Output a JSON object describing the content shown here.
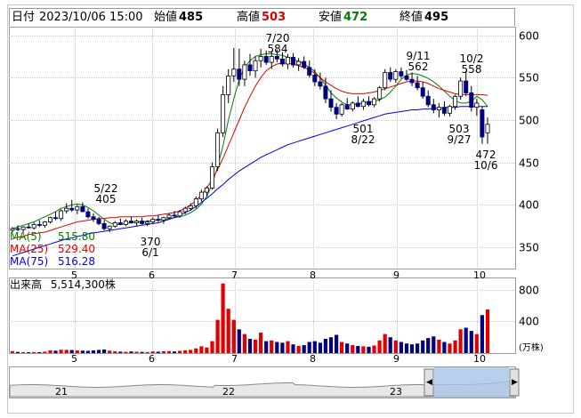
{
  "header": {
    "date_label": "日付",
    "date_value": "2023/10/06 15:00",
    "open_label": "始値",
    "open_value": "485",
    "high_label": "高値",
    "high_value": "503",
    "low_label": "安値",
    "low_value": "472",
    "close_label": "終値",
    "close_value": "495"
  },
  "moving_averages": [
    {
      "label": "MA(5)",
      "value": "515.80",
      "color": "#008000"
    },
    {
      "label": "MA(25)",
      "value": "529.40",
      "color": "#e00000"
    },
    {
      "label": "MA(75)",
      "value": "516.28",
      "color": "#0000e0"
    }
  ],
  "volume_header": {
    "label": "出来高",
    "value": "5,514,300株"
  },
  "volume_unit": "(万株)",
  "colors": {
    "up": "#ffffff",
    "down": "#000080",
    "vol_up": "#e00000",
    "vol_down": "#000080",
    "grid": "#c8c8c8",
    "navigator": "#a8c4e8"
  },
  "chart_data": {
    "type": "candlestick",
    "x_tick_labels": [
      "5",
      "6",
      "7",
      "8",
      "9",
      "10"
    ],
    "price_ylim": [
      325,
      610
    ],
    "price_ticks": [
      350,
      400,
      450,
      500,
      550,
      600
    ],
    "volume_ticks": [
      400,
      800
    ],
    "volume_ylim": [
      0,
      1000
    ],
    "annotations": [
      {
        "date": "5/22",
        "price": "405"
      },
      {
        "date": "6/1",
        "price": "370"
      },
      {
        "date": "7/20",
        "price": "584"
      },
      {
        "date": "8/22",
        "price": "501"
      },
      {
        "date": "9/11",
        "price": "562"
      },
      {
        "date": "9/27",
        "price": "503"
      },
      {
        "date": "10/2",
        "price": "558"
      },
      {
        "date": "10/6",
        "price": "472"
      }
    ],
    "series": [
      {
        "name": "MA(5)",
        "values": [
          372,
          374,
          376,
          378,
          380,
          383,
          386,
          389,
          392,
          396,
          398,
          400,
          401,
          400,
          397,
          393,
          388,
          383,
          379,
          377,
          377,
          378,
          379,
          380,
          380,
          381,
          382,
          382,
          383,
          384,
          385,
          386,
          388,
          391,
          395,
          401,
          410,
          425,
          445,
          470,
          500,
          525,
          548,
          562,
          570,
          575,
          577,
          578,
          578,
          577,
          576,
          574,
          572,
          569,
          566,
          562,
          557,
          550,
          541,
          532,
          526,
          521,
          518,
          518,
          519,
          520,
          521,
          522,
          524,
          527,
          533,
          540,
          548,
          553,
          555,
          554,
          552,
          549,
          545,
          540,
          534,
          528,
          523,
          520,
          520,
          522,
          528,
          524,
          516
        ]
      },
      {
        "name": "MA(25)",
        "values": [
          360,
          362,
          363,
          365,
          366,
          367,
          368,
          370,
          372,
          374,
          376,
          378,
          380,
          381,
          382,
          383,
          384,
          384,
          385,
          385,
          386,
          386,
          386,
          386,
          386,
          387,
          387,
          388,
          389,
          390,
          391,
          393,
          396,
          400,
          405,
          412,
          420,
          430,
          442,
          455,
          470,
          485,
          500,
          515,
          528,
          540,
          550,
          558,
          563,
          566,
          567,
          567,
          566,
          564,
          562,
          559,
          555,
          550,
          545,
          541,
          537,
          534,
          532,
          531,
          531,
          531,
          532,
          533,
          535,
          537,
          539,
          541,
          543,
          545,
          546,
          546,
          545,
          543,
          540,
          537,
          535,
          533,
          531,
          530,
          530,
          530,
          530,
          530,
          529
        ]
      },
      {
        "name": "MA(75)",
        "values": [
          340,
          342,
          344,
          346,
          348,
          350,
          352,
          354,
          356,
          358,
          360,
          361,
          363,
          364,
          366,
          367,
          368,
          369,
          370,
          371,
          372,
          373,
          374,
          375,
          376,
          377,
          378,
          379,
          381,
          383,
          385,
          388,
          391,
          394,
          398,
          403,
          408,
          413,
          419,
          424,
          430,
          435,
          440,
          444,
          448,
          452,
          456,
          459,
          462,
          465,
          468,
          471,
          473,
          475,
          477,
          479,
          481,
          483,
          485,
          487,
          489,
          491,
          493,
          495,
          497,
          499,
          501,
          503,
          505,
          507,
          508,
          509,
          510,
          511,
          512,
          512,
          513,
          513,
          514,
          514,
          515,
          515,
          515,
          516,
          516,
          516,
          516,
          516,
          516
        ]
      }
    ],
    "candles": [
      [
        370,
        374,
        368,
        372,
        25
      ],
      [
        372,
        376,
        369,
        371,
        15
      ],
      [
        371,
        375,
        368,
        374,
        12
      ],
      [
        374,
        378,
        372,
        373,
        10
      ],
      [
        373,
        379,
        371,
        377,
        14
      ],
      [
        377,
        382,
        374,
        376,
        12
      ],
      [
        376,
        381,
        373,
        380,
        18
      ],
      [
        380,
        386,
        378,
        385,
        35
      ],
      [
        385,
        392,
        382,
        384,
        30
      ],
      [
        384,
        395,
        381,
        393,
        42
      ],
      [
        393,
        402,
        390,
        396,
        40
      ],
      [
        396,
        406,
        392,
        394,
        38
      ],
      [
        394,
        400,
        389,
        398,
        33
      ],
      [
        398,
        403,
        393,
        392,
        30
      ],
      [
        392,
        396,
        384,
        386,
        28
      ],
      [
        386,
        390,
        380,
        383,
        34
      ],
      [
        383,
        386,
        376,
        378,
        40
      ],
      [
        378,
        382,
        370,
        372,
        45
      ],
      [
        372,
        376,
        368,
        375,
        30
      ],
      [
        375,
        381,
        373,
        379,
        22
      ],
      [
        379,
        384,
        376,
        377,
        18
      ],
      [
        377,
        383,
        375,
        381,
        16
      ],
      [
        381,
        386,
        378,
        379,
        20
      ],
      [
        379,
        383,
        375,
        381,
        17
      ],
      [
        381,
        385,
        377,
        378,
        15
      ],
      [
        378,
        382,
        375,
        380,
        14
      ],
      [
        380,
        385,
        378,
        383,
        20
      ],
      [
        383,
        388,
        380,
        382,
        18
      ],
      [
        382,
        386,
        378,
        385,
        22
      ],
      [
        385,
        390,
        383,
        388,
        25
      ],
      [
        388,
        393,
        385,
        387,
        20
      ],
      [
        387,
        394,
        385,
        392,
        28
      ],
      [
        392,
        398,
        389,
        396,
        35
      ],
      [
        396,
        402,
        393,
        399,
        40
      ],
      [
        399,
        410,
        396,
        407,
        60
      ],
      [
        407,
        418,
        404,
        415,
        85
      ],
      [
        415,
        422,
        410,
        420,
        70
      ],
      [
        420,
        450,
        418,
        445,
        150
      ],
      [
        445,
        490,
        440,
        485,
        420
      ],
      [
        485,
        540,
        480,
        530,
        880
      ],
      [
        530,
        560,
        520,
        552,
        560
      ],
      [
        552,
        585,
        545,
        560,
        420
      ],
      [
        560,
        584,
        540,
        548,
        300
      ],
      [
        548,
        570,
        540,
        565,
        240
      ],
      [
        565,
        578,
        552,
        558,
        180
      ],
      [
        558,
        575,
        550,
        570,
        170
      ],
      [
        570,
        584,
        562,
        575,
        260
      ],
      [
        575,
        582,
        565,
        568,
        150
      ],
      [
        568,
        580,
        560,
        575,
        160
      ],
      [
        575,
        583,
        568,
        572,
        140
      ],
      [
        572,
        580,
        563,
        566,
        130
      ],
      [
        566,
        578,
        560,
        574,
        150
      ],
      [
        574,
        579,
        562,
        565,
        110
      ],
      [
        565,
        573,
        558,
        569,
        90
      ],
      [
        569,
        575,
        560,
        562,
        100
      ],
      [
        562,
        570,
        550,
        553,
        140
      ],
      [
        553,
        560,
        540,
        545,
        150
      ],
      [
        545,
        556,
        536,
        540,
        130
      ],
      [
        540,
        550,
        520,
        525,
        180
      ],
      [
        525,
        535,
        510,
        515,
        200
      ],
      [
        515,
        520,
        501,
        507,
        230
      ],
      [
        507,
        520,
        504,
        518,
        140
      ],
      [
        518,
        526,
        512,
        513,
        120
      ],
      [
        513,
        522,
        510,
        520,
        100
      ],
      [
        520,
        528,
        515,
        516,
        90
      ],
      [
        516,
        525,
        512,
        522,
        85
      ],
      [
        522,
        528,
        516,
        518,
        80
      ],
      [
        518,
        527,
        515,
        525,
        95
      ],
      [
        525,
        540,
        522,
        538,
        160
      ],
      [
        538,
        560,
        535,
        556,
        240
      ],
      [
        556,
        562,
        545,
        548,
        200
      ],
      [
        548,
        560,
        544,
        557,
        160
      ],
      [
        557,
        562,
        549,
        552,
        140
      ],
      [
        552,
        559,
        546,
        548,
        120
      ],
      [
        548,
        556,
        540,
        544,
        110
      ],
      [
        544,
        552,
        535,
        538,
        120
      ],
      [
        538,
        545,
        525,
        528,
        160
      ],
      [
        528,
        535,
        515,
        518,
        190
      ],
      [
        518,
        525,
        508,
        512,
        210
      ],
      [
        512,
        520,
        503,
        515,
        170
      ],
      [
        515,
        522,
        505,
        508,
        140
      ],
      [
        508,
        518,
        504,
        516,
        120
      ],
      [
        516,
        530,
        512,
        528,
        160
      ],
      [
        528,
        550,
        524,
        546,
        300
      ],
      [
        546,
        558,
        528,
        532,
        320
      ],
      [
        532,
        540,
        510,
        515,
        280
      ],
      [
        515,
        525,
        505,
        520,
        240
      ],
      [
        512,
        516,
        472,
        480,
        480
      ],
      [
        485,
        503,
        472,
        495,
        551
      ]
    ]
  }
}
